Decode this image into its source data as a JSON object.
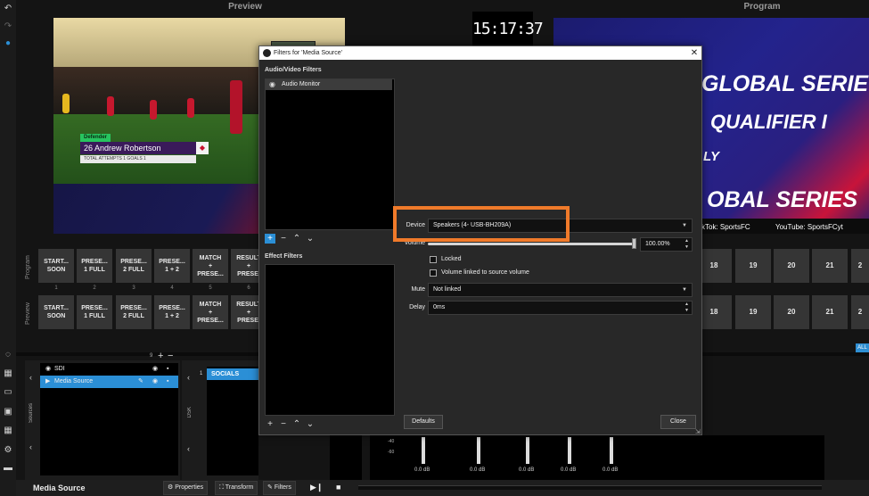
{
  "header": {
    "preview": "Preview",
    "program": "Program"
  },
  "clock": "15:17:37",
  "preview_overlay": {
    "tag": "Defender",
    "player": "26 Andrew Robertson",
    "stats": "TOTAL ATTEMPTS 1  GOALS 1"
  },
  "program_overlay": {
    "line1": "GLOBAL SERIE",
    "line2": "QUALIFIER I",
    "line3": "LY",
    "line4": "OBAL SERIES",
    "tiktok": "kTok: SportsFC",
    "youtube": "YouTube: SportsFCyt"
  },
  "grid": {
    "program_label": "Program",
    "preview_label": "Preview",
    "buttons": [
      {
        "l1": "START...",
        "l2": "SOON",
        "num": "1"
      },
      {
        "l1": "PRESE...",
        "l2": "1 FULL",
        "num": "2"
      },
      {
        "l1": "PRESE...",
        "l2": "2 FULL",
        "num": "3"
      },
      {
        "l1": "PRESE...",
        "l2": "1 + 2",
        "num": "4"
      },
      {
        "l1": "MATCH",
        "l2": "+",
        "l3": "PRESE...",
        "num": "5"
      },
      {
        "l1": "RESULT",
        "l2": "+",
        "l3": "PRESE.",
        "num": "6"
      }
    ],
    "right_numbers": [
      "18",
      "19",
      "20",
      "21",
      "2"
    ],
    "all_badge": "ALL"
  },
  "sources": {
    "label": "Sources",
    "count": "9",
    "items": [
      {
        "name": "SDI",
        "selected": false
      },
      {
        "name": "Media Source",
        "selected": true
      }
    ]
  },
  "dsk": {
    "label": "DSK",
    "index": "1",
    "item": "SOCIALS"
  },
  "mixer": {
    "ticks": [
      "-40",
      "-60"
    ],
    "levels": [
      "0.0 dB",
      "0.0 dB",
      "0.0 dB",
      "0.0 dB",
      "0.0 dB"
    ]
  },
  "statusbar": {
    "title": "Media Source",
    "properties": "Properties",
    "transform": "Transform",
    "filters": "Filters"
  },
  "dialog": {
    "title": "Filters for 'Media Source'",
    "close_x": "✕",
    "av_filters_label": "Audio/Video Filters",
    "av_filters": [
      "Audio Monitor"
    ],
    "effect_filters_label": "Effect Filters",
    "device_label": "Device",
    "device_value": "Speakers (4- USB-BH209A)",
    "volume_label": "Volume",
    "volume_value": "100.00%",
    "volume_level": 1.0,
    "locked_label": "Locked",
    "linked_label": "Volume linked to source volume",
    "mute_label": "Mute",
    "mute_value": "Not linked",
    "delay_label": "Delay",
    "delay_value": "0ms",
    "defaults_button": "Defaults",
    "close_button": "Close"
  },
  "colors": {
    "accent": "#2b8fd6",
    "highlight": "#f07a2a"
  }
}
